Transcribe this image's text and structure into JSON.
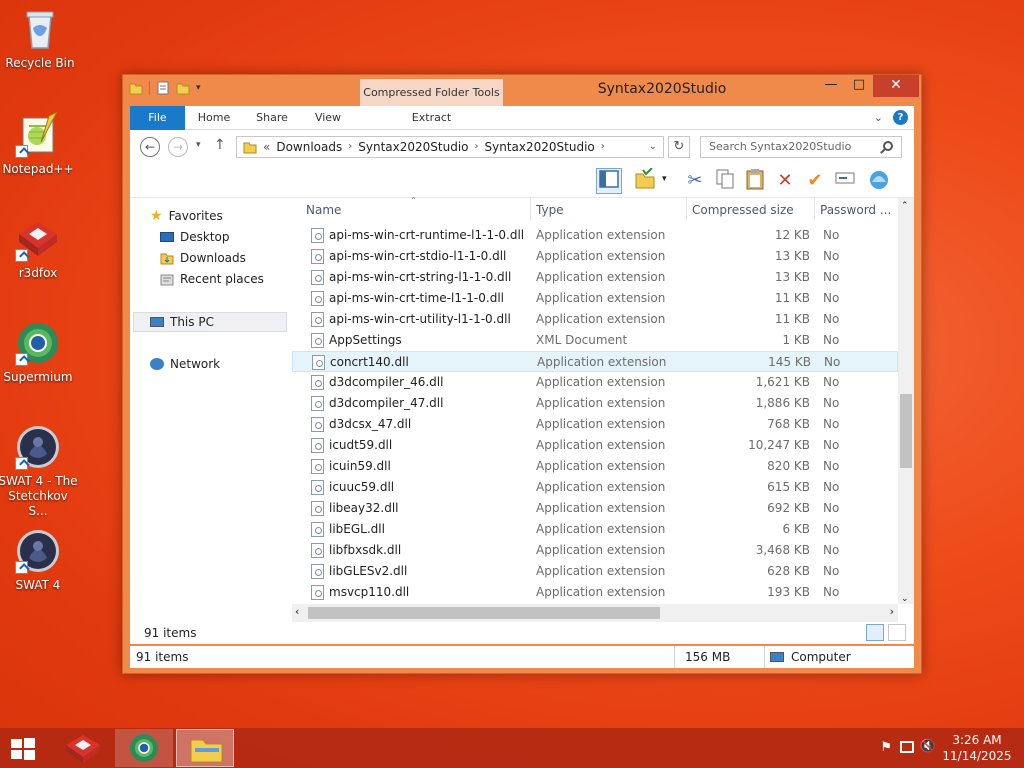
{
  "desktop": {
    "icons": [
      {
        "label": "Recycle Bin"
      },
      {
        "label": "Notepad++"
      },
      {
        "label": "r3dfox"
      },
      {
        "label": "Supermium"
      },
      {
        "label": "SWAT 4 - The Stetchkov S..."
      },
      {
        "label": "SWAT 4"
      }
    ]
  },
  "window": {
    "title": "Syntax2020Studio",
    "context_tab": "Compressed Folder Tools",
    "ribbon_tabs": [
      "File",
      "Home",
      "Share",
      "View",
      "Extract"
    ],
    "address": {
      "prefix": "«",
      "crumbs": [
        "Downloads",
        "Syntax2020Studio",
        "Syntax2020Studio"
      ]
    },
    "search_placeholder": "Search Syntax2020Studio",
    "nav_pane": {
      "favorites": "Favorites",
      "desktop": "Desktop",
      "downloads": "Downloads",
      "recent": "Recent places",
      "this_pc": "This PC",
      "network": "Network"
    },
    "columns": [
      "Name",
      "Type",
      "Compressed size",
      "Password ..."
    ],
    "files": [
      {
        "name": "api-ms-win-crt-runtime-l1-1-0.dll",
        "type": "Application extension",
        "size": "12 KB",
        "password": "No"
      },
      {
        "name": "api-ms-win-crt-stdio-l1-1-0.dll",
        "type": "Application extension",
        "size": "13 KB",
        "password": "No"
      },
      {
        "name": "api-ms-win-crt-string-l1-1-0.dll",
        "type": "Application extension",
        "size": "13 KB",
        "password": "No"
      },
      {
        "name": "api-ms-win-crt-time-l1-1-0.dll",
        "type": "Application extension",
        "size": "11 KB",
        "password": "No"
      },
      {
        "name": "api-ms-win-crt-utility-l1-1-0.dll",
        "type": "Application extension",
        "size": "11 KB",
        "password": "No"
      },
      {
        "name": "AppSettings",
        "type": "XML Document",
        "size": "1 KB",
        "password": "No"
      },
      {
        "name": "concrt140.dll",
        "type": "Application extension",
        "size": "145 KB",
        "password": "No"
      },
      {
        "name": "d3dcompiler_46.dll",
        "type": "Application extension",
        "size": "1,621 KB",
        "password": "No"
      },
      {
        "name": "d3dcompiler_47.dll",
        "type": "Application extension",
        "size": "1,886 KB",
        "password": "No"
      },
      {
        "name": "d3dcsx_47.dll",
        "type": "Application extension",
        "size": "768 KB",
        "password": "No"
      },
      {
        "name": "icudt59.dll",
        "type": "Application extension",
        "size": "10,247 KB",
        "password": "No"
      },
      {
        "name": "icuin59.dll",
        "type": "Application extension",
        "size": "820 KB",
        "password": "No"
      },
      {
        "name": "icuuc59.dll",
        "type": "Application extension",
        "size": "615 KB",
        "password": "No"
      },
      {
        "name": "libeay32.dll",
        "type": "Application extension",
        "size": "692 KB",
        "password": "No"
      },
      {
        "name": "libEGL.dll",
        "type": "Application extension",
        "size": "6 KB",
        "password": "No"
      },
      {
        "name": "libfbxsdk.dll",
        "type": "Application extension",
        "size": "3,468 KB",
        "password": "No"
      },
      {
        "name": "libGLESv2.dll",
        "type": "Application extension",
        "size": "628 KB",
        "password": "No"
      },
      {
        "name": "msvcp110.dll",
        "type": "Application extension",
        "size": "193 KB",
        "password": "No"
      }
    ],
    "status_items": "91 items",
    "info_items": "91 items",
    "info_size": "156 MB",
    "info_location": "Computer"
  },
  "taskbar": {
    "time": "3:26 AM",
    "date": "11/14/2025"
  },
  "colors": {
    "desktop": "#ee4c1b",
    "window_frame": "#f08a4b",
    "file_tab": "#1979ca",
    "selection": "#e5f3fb"
  }
}
